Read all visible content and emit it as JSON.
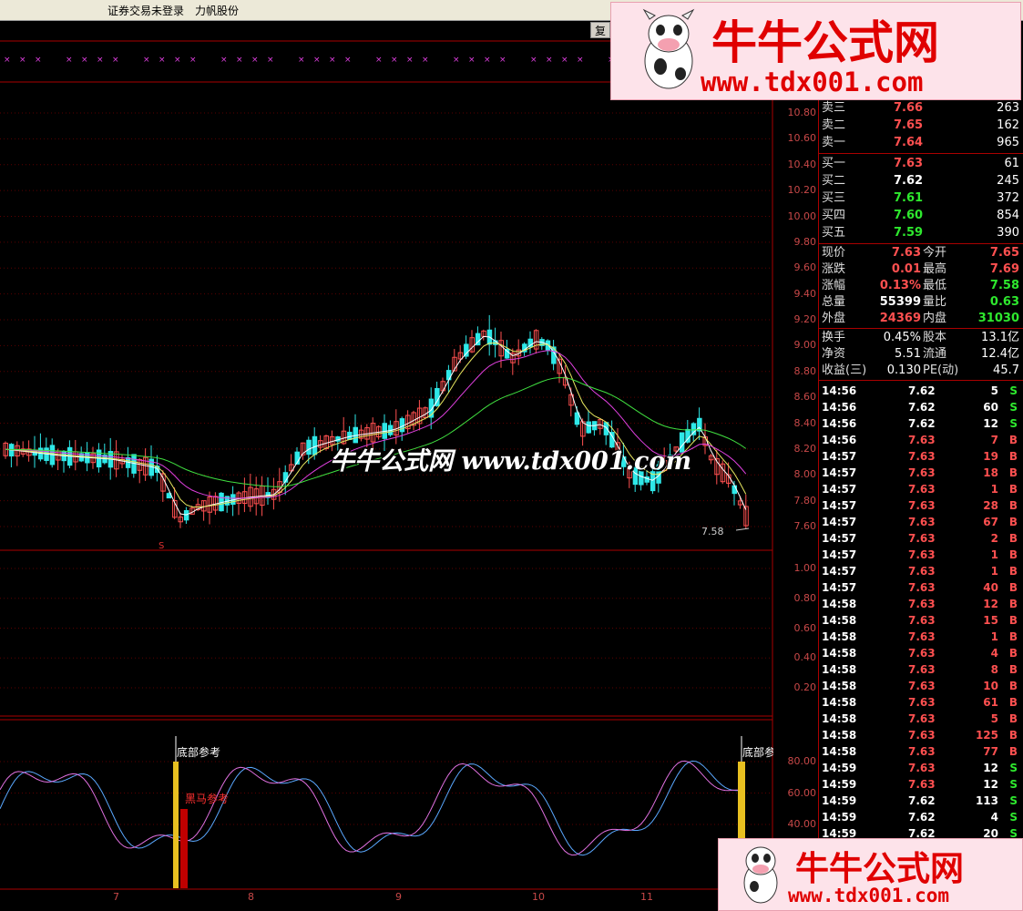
{
  "topbar": {
    "login_status": "证券交易未登录",
    "stock_name": "力帆股份"
  },
  "toolbar": {
    "fq_label": "复权"
  },
  "banner": {
    "title": "牛牛公式网",
    "url": "www.tdx001.com"
  },
  "watermark": "牛牛公式网 www.tdx001.com",
  "price_axis": [
    "10.80",
    "10.60",
    "10.40",
    "10.20",
    "10.00",
    "9.80",
    "9.60",
    "9.40",
    "9.20",
    "9.00",
    "8.80",
    "8.60",
    "8.40",
    "8.20",
    "8.00",
    "7.80",
    "7.60"
  ],
  "vol_axis": [
    "1.00",
    "0.80",
    "0.60",
    "0.40",
    "0.20"
  ],
  "osc_axis": [
    "80.00",
    "60.00",
    "40.00"
  ],
  "date_axis": [
    "7",
    "8",
    "9",
    "10",
    "11"
  ],
  "annotations": {
    "low_price": "7.58",
    "s_marker": "S",
    "bottom_ref_1": "底部参考",
    "bottom_ref_2": "底部参",
    "dark_horse": "黑马参考"
  },
  "order_book": {
    "asks": [
      {
        "label": "卖三",
        "price": "7.66",
        "vol": "263"
      },
      {
        "label": "卖二",
        "price": "7.65",
        "vol": "162"
      },
      {
        "label": "卖一",
        "price": "7.64",
        "vol": "965"
      }
    ],
    "bids": [
      {
        "label": "买一",
        "price": "7.63",
        "vol": "61"
      },
      {
        "label": "买二",
        "price": "7.62",
        "vol": "245"
      },
      {
        "label": "买三",
        "price": "7.61",
        "vol": "372"
      },
      {
        "label": "买四",
        "price": "7.60",
        "vol": "854"
      },
      {
        "label": "买五",
        "price": "7.59",
        "vol": "390"
      }
    ]
  },
  "quote": {
    "xj_label": "现价",
    "xj": "7.63",
    "jk_label": "今开",
    "jk": "7.65",
    "zd_label": "涨跌",
    "zd": "0.01",
    "zg_label": "最高",
    "zg": "7.69",
    "zf_label": "涨幅",
    "zf": "0.13%",
    "zdi_label": "最低",
    "zdi": "7.58",
    "zl_label": "总量",
    "zl": "55399",
    "lb_label": "量比",
    "lb": "0.63",
    "wp_label": "外盘",
    "wp": "24369",
    "np_label": "内盘",
    "np": "31030"
  },
  "finance": {
    "hs_label": "换手",
    "hs": "0.45%",
    "gb_label": "股本",
    "gb": "13.1亿",
    "jz_label": "净资",
    "jz": "5.51",
    "lt_label": "流通",
    "lt": "12.4亿",
    "sy_label": "收益(三)",
    "sy": "0.130",
    "pe_label": "PE(动)",
    "pe": "45.7"
  },
  "ticks": [
    {
      "t": "14:56",
      "p": "7.62",
      "v": "5",
      "d": "S"
    },
    {
      "t": "14:56",
      "p": "7.62",
      "v": "60",
      "d": "S"
    },
    {
      "t": "14:56",
      "p": "7.62",
      "v": "12",
      "d": "S"
    },
    {
      "t": "14:56",
      "p": "7.63",
      "v": "7",
      "d": "B"
    },
    {
      "t": "14:57",
      "p": "7.63",
      "v": "19",
      "d": "B"
    },
    {
      "t": "14:57",
      "p": "7.63",
      "v": "18",
      "d": "B"
    },
    {
      "t": "14:57",
      "p": "7.63",
      "v": "1",
      "d": "B"
    },
    {
      "t": "14:57",
      "p": "7.63",
      "v": "28",
      "d": "B"
    },
    {
      "t": "14:57",
      "p": "7.63",
      "v": "67",
      "d": "B"
    },
    {
      "t": "14:57",
      "p": "7.63",
      "v": "2",
      "d": "B"
    },
    {
      "t": "14:57",
      "p": "7.63",
      "v": "1",
      "d": "B"
    },
    {
      "t": "14:57",
      "p": "7.63",
      "v": "1",
      "d": "B"
    },
    {
      "t": "14:57",
      "p": "7.63",
      "v": "40",
      "d": "B"
    },
    {
      "t": "14:58",
      "p": "7.63",
      "v": "12",
      "d": "B"
    },
    {
      "t": "14:58",
      "p": "7.63",
      "v": "15",
      "d": "B"
    },
    {
      "t": "14:58",
      "p": "7.63",
      "v": "1",
      "d": "B"
    },
    {
      "t": "14:58",
      "p": "7.63",
      "v": "4",
      "d": "B"
    },
    {
      "t": "14:58",
      "p": "7.63",
      "v": "8",
      "d": "B"
    },
    {
      "t": "14:58",
      "p": "7.63",
      "v": "10",
      "d": "B"
    },
    {
      "t": "14:58",
      "p": "7.63",
      "v": "61",
      "d": "B"
    },
    {
      "t": "14:58",
      "p": "7.63",
      "v": "5",
      "d": "B"
    },
    {
      "t": "14:58",
      "p": "7.63",
      "v": "125",
      "d": "B"
    },
    {
      "t": "14:58",
      "p": "7.63",
      "v": "77",
      "d": "B"
    },
    {
      "t": "14:59",
      "p": "7.63",
      "v": "12",
      "d": "S"
    },
    {
      "t": "14:59",
      "p": "7.63",
      "v": "12",
      "d": "S"
    },
    {
      "t": "14:59",
      "p": "7.62",
      "v": "113",
      "d": "S"
    },
    {
      "t": "14:59",
      "p": "7.62",
      "v": "4",
      "d": "S"
    },
    {
      "t": "14:59",
      "p": "7.62",
      "v": "20",
      "d": "S"
    }
  ],
  "colors": {
    "up": "#ff5050",
    "down": "#2ee8e8",
    "grid": "#8b0000",
    "accent": "#e00000"
  }
}
